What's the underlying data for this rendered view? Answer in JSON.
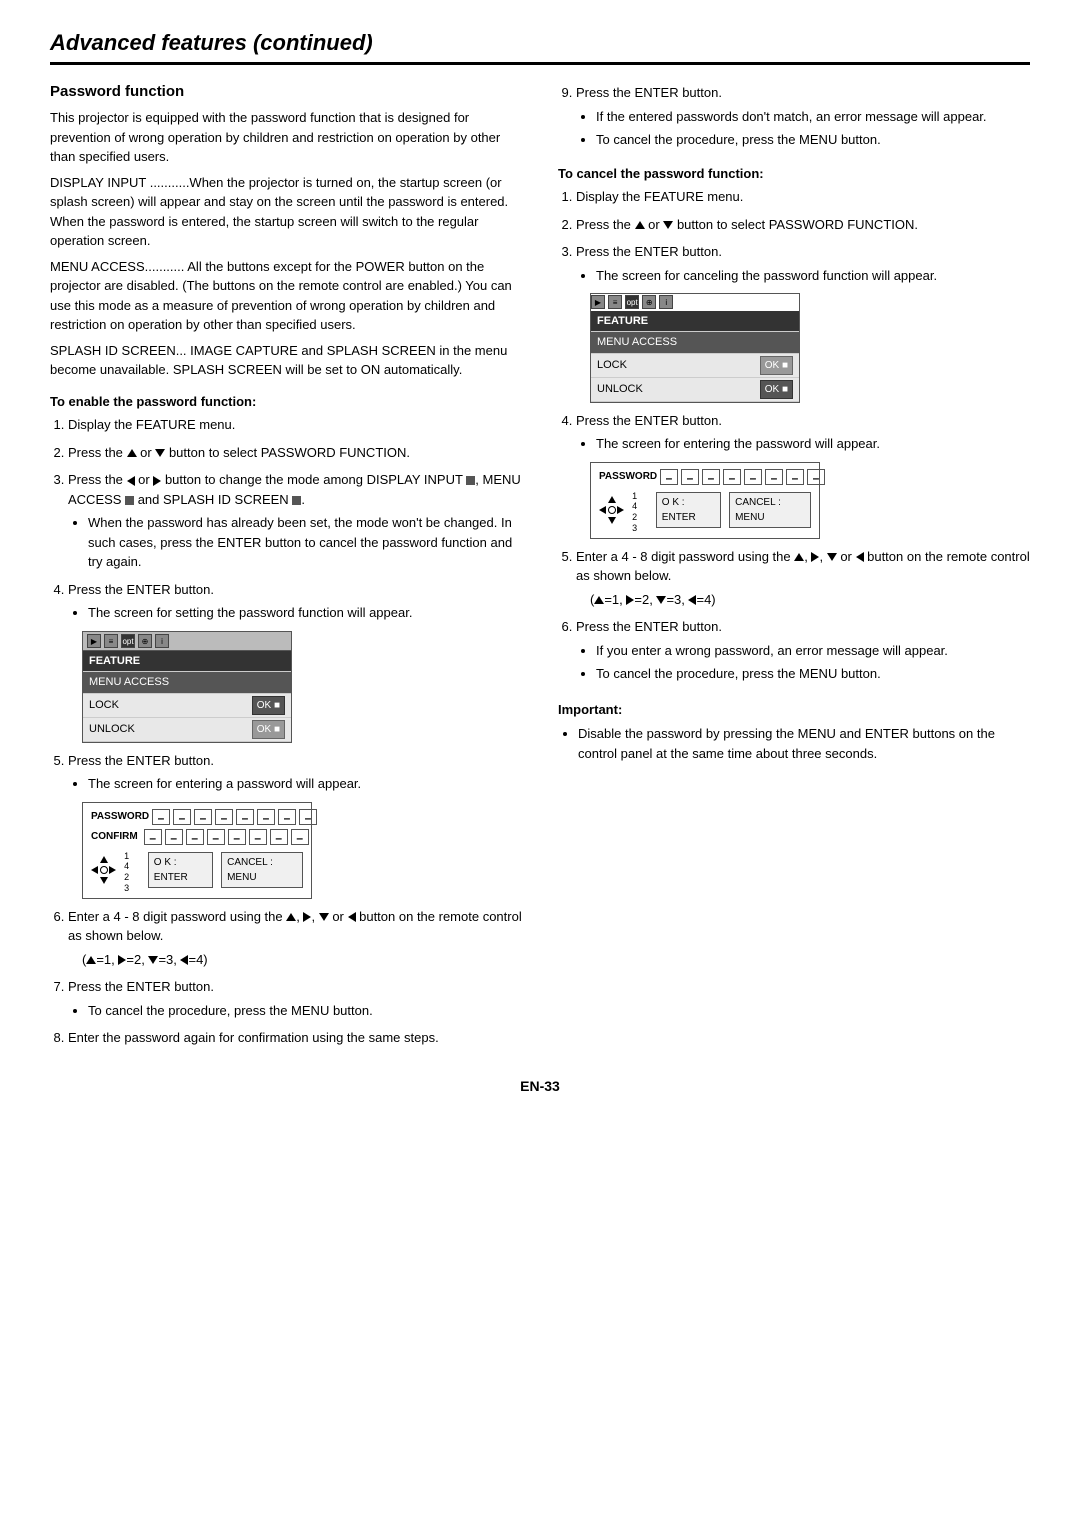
{
  "page": {
    "title": "Advanced features (continued)",
    "page_number": "EN-33"
  },
  "left_col": {
    "section_title": "Password function",
    "intro": "This projector is equipped with the password function that is designed for prevention of wrong operation by children and restriction on operation by other than specified users.",
    "display_input_text": "DISPLAY INPUT ...........When the projector is turned on, the startup screen (or splash screen) will appear and stay on the screen until the password is entered. When the password is entered, the startup screen will switch to the regular operation screen.",
    "menu_access_text": "MENU ACCESS........... All the buttons except for the POWER button on the projector are disabled. (The buttons on the remote control are enabled.) You can use this mode as a measure of prevention of wrong operation by children and restriction on operation by other than specified users.",
    "splash_id_text": "SPLASH ID SCREEN... IMAGE CAPTURE and SPLASH SCREEN in the menu become unavailable. SPLASH SCREEN will be set to ON automatically.",
    "enable_title": "To enable the password function:",
    "enable_steps": [
      "Display the FEATURE menu.",
      "Press the ▲ or ▼ button to select PASSWORD FUNCTION.",
      "Press the ◄ or ► button to change the mode among DISPLAY INPUT ■, MENU ACCESS ■ and SPLASH ID SCREEN ■.",
      "When the password has already been set, the mode won't be changed. In such cases, press the ENTER button to cancel the password function and try again.",
      "Press the ENTER button.",
      "Press the ENTER button.",
      "Press the ENTER button.",
      "Enter the password again for confirmation using the same steps."
    ],
    "step4_bullet": "The screen for setting the password function will appear.",
    "step5_bullet": "The screen for entering a password will appear.",
    "step6_text": "Enter a 4 - 8 digit password using the ▲, ►, ▼ or ◄ button on the remote control as shown below.",
    "step6_formula": "(▲=1, ►=2, ▼=3, ◄=4)",
    "step7_bullet": "To cancel the procedure, press the MENU button.",
    "menu_feature_label": "FEATURE",
    "menu_access_label": "MENU ACCESS",
    "menu_lock_label": "LOCK",
    "menu_unlock_label": "UNLOCK",
    "menu_ok_label": "OK ■",
    "pw_label": "PASSWORD",
    "confirm_label": "CONFIRM",
    "ok_enter_label": "O K : ENTER",
    "cancel_menu_label": "CANCEL : MENU"
  },
  "right_col": {
    "step9_text": "Press the ENTER button.",
    "step9_b1": "If the entered passwords don't match, an error message will appear.",
    "step9_b2": "To cancel the procedure, press the MENU button.",
    "cancel_title": "To cancel the password function:",
    "cancel_steps": [
      "Display the FEATURE menu.",
      "Press the ▲ or ▼ button to select PASSWORD FUNCTION.",
      "Press the ENTER button."
    ],
    "cancel_step3_bullet": "The screen for canceling the password function will appear.",
    "cancel_step4_text": "Press the ENTER button.",
    "cancel_step4_bullet": "The screen for entering the password will appear.",
    "cancel_step5_text": "Enter a 4 - 8 digit password using the ▲, ►, ▼ or ◄ button on the remote control as shown below.",
    "cancel_step5_formula": "(▲=1, ►=2, ▼=3, ◄=4)",
    "cancel_step6_text": "Press the ENTER button.",
    "cancel_step6_b1": "If you enter a wrong password, an error message will appear.",
    "cancel_step6_b2": "To cancel the procedure, press the MENU button.",
    "important_label": "Important:",
    "important_bullet": "Disable the password by pressing the MENU and ENTER buttons on the control panel at the same time about three seconds.",
    "menu_feature_label": "FEATURE",
    "menu_access_label": "MENU ACCESS",
    "menu_lock_label": "LOCK",
    "menu_unlock_label": "UNLOCK",
    "menu_ok_label": "OK ■",
    "pw_label": "PASSWORD",
    "ok_enter_label": "O K : ENTER",
    "cancel_menu_label": "CANCEL : MENU"
  }
}
